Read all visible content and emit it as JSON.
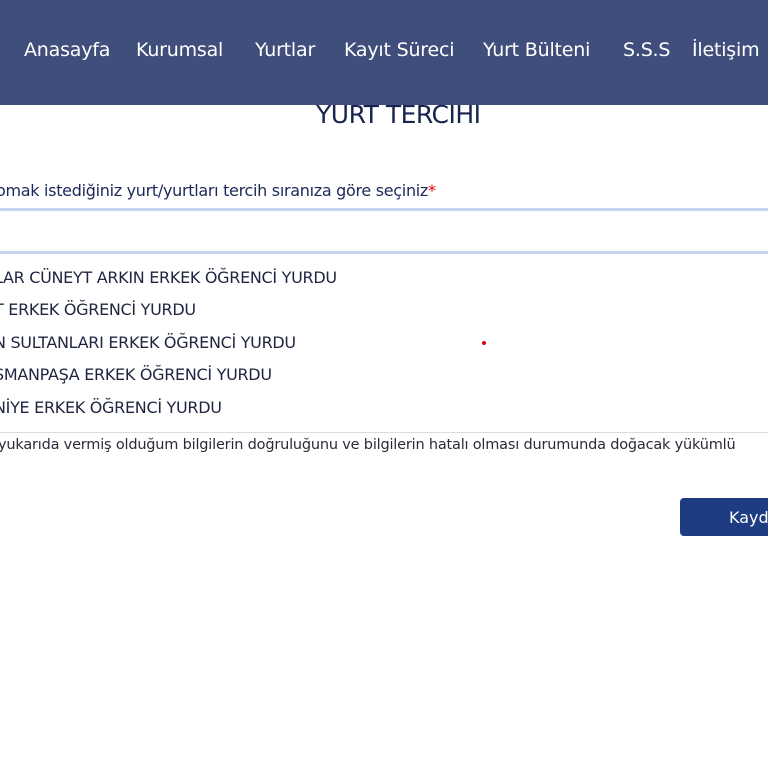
{
  "nav": {
    "items": [
      "Anasayfa",
      "Kurumsal",
      "Yurtlar",
      "Kayıt Süreci",
      "Yurt Bülteni",
      "S.S.S",
      "İletişim"
    ]
  },
  "form": {
    "title": "YURT TERCIHI",
    "label": "omak istediğiniz yurt/yurtları tercih sıranıza göre seçiniz",
    "required_mark": "*",
    "options": [
      "LAR CÜNEYT ARKIN ERKEK ÖĞRENCİ YURDU",
      "T ERKEK ÖĞRENCİ YURDU",
      "N SULTANLARI ERKEK ÖĞRENCİ YURDU",
      "SMANPAŞA ERKEK ÖĞRENCİ YURDU",
      "NİYE ERKEK ÖĞRENCİ YURDU"
    ],
    "disclaimer": " yukarıda vermiş olduğum bilgilerin doğruluğunu ve bilgilerin hatalı olması durumunda doğacak yükümlü",
    "submit_label": "Kaydet"
  },
  "colors": {
    "nav_bg": "#3f4e7b",
    "button_bg": "#1d3c81",
    "required": "#e00000"
  }
}
